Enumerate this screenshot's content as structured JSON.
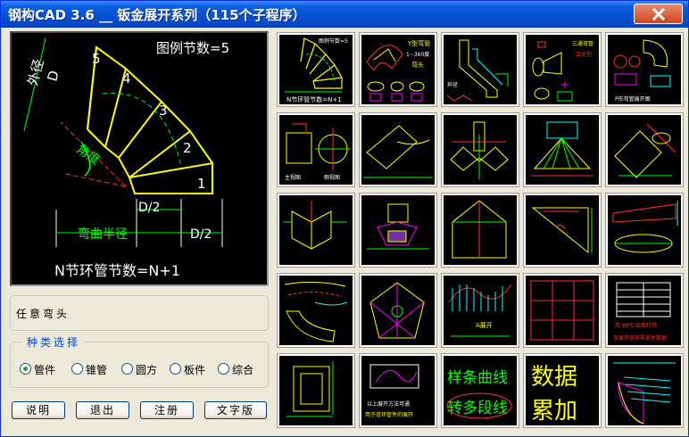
{
  "window": {
    "title": "钢构CAD 3.6 __ 钣金展开系列（115个子程序）"
  },
  "preview": {
    "legend_count_text": "图例节数=5",
    "outer_diameter_label": "外径",
    "outer_diameter_symbol": "D",
    "angle_label": "角度",
    "bend_radius_label": "弯曲半径",
    "half_d_label_1": "D/2",
    "half_d_label_2": "D/2",
    "segment_numbers": [
      "1",
      "2",
      "3",
      "4",
      "5"
    ],
    "footer_text": "N节环管节数=N+1"
  },
  "selection_panel": {
    "text": "任意弯头"
  },
  "category_group": {
    "legend": "种类选择",
    "options": [
      {
        "label": "管件",
        "selected": true
      },
      {
        "label": "锥管",
        "selected": false
      },
      {
        "label": "圆方",
        "selected": false
      },
      {
        "label": "板件",
        "selected": false
      },
      {
        "label": "综合",
        "selected": false
      }
    ]
  },
  "buttons": {
    "help": "说明",
    "exit": "退出",
    "register": "注册",
    "text_version": "文字版"
  },
  "thumbnails": {
    "r1c1_title": "图例节数=5",
    "r1c1_foot": "N节环管节数=N+1",
    "r1c2_top": "Y型弯管",
    "r1c2_mid": "1~360度",
    "r1c2_bot": "弯头",
    "r1c3_label": "异径",
    "r1c4_top": "三通弯管",
    "r1c4_mid": "正对型",
    "r1c5_foot": "P形弯管展开图",
    "r2c1_left": "主视图",
    "r2c1_right": "侧视图",
    "r4c3_label": "A展开",
    "r4c5_mid": "用 WPS 绘图打开",
    "r4c5_foot": "及展开放样零部件数据",
    "r5c2_line1": "以上展开方法可通",
    "r5c2_line2": "用于连环管件的展开",
    "r5c3_line1": "样条曲线",
    "r5c3_line2": "转多段线",
    "r5c4_line1": "数据",
    "r5c4_line2": "累加"
  },
  "colors": {
    "title_gradient_top": "#3a8cff",
    "title_gradient_bottom": "#0339b0",
    "drawing_yellow": "#ffff00",
    "drawing_green": "#00ff00",
    "drawing_red": "#ff3030",
    "legend_blue": "#0046d5"
  }
}
